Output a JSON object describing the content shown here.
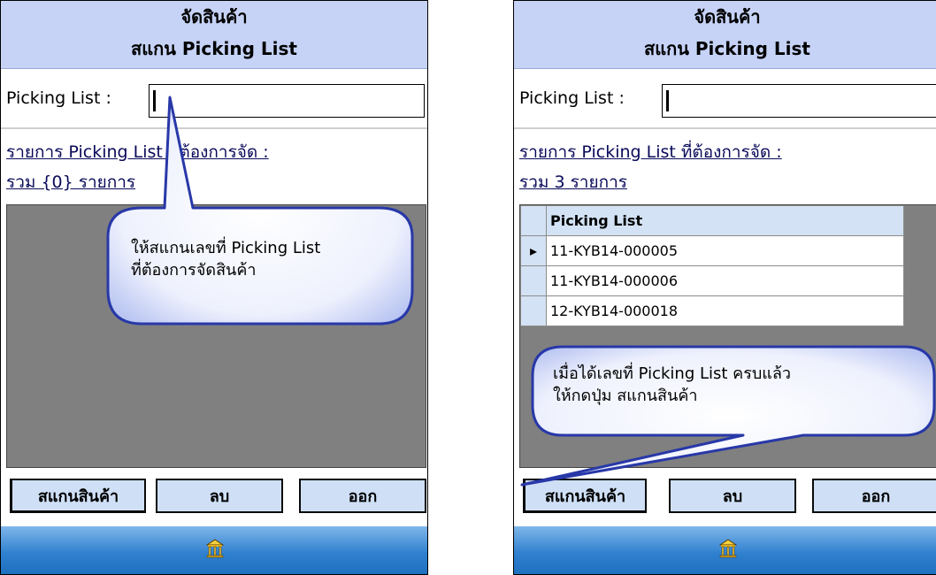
{
  "screens": [
    {
      "title_line1": "จัดสินค้า",
      "title_line2": "สแกน Picking List",
      "field_label": "Picking List :",
      "field_value": "",
      "link_line1": "รายการ Picking List ที่ต้องการจัด :",
      "link_line2": "รวม {0} รายการ",
      "buttons": [
        "สแกนสินค้า",
        "ลบ",
        "ออก"
      ],
      "callout": [
        "ให้สแกนเลขที่ Picking List",
        "ที่ต้องการจัดสินค้า"
      ]
    },
    {
      "title_line1": "จัดสินค้า",
      "title_line2": "สแกน Picking List",
      "field_label": "Picking List :",
      "field_value": "",
      "link_line1": "รายการ Picking List ที่ต้องการจัด :",
      "link_line2": "รวม 3 รายการ",
      "table": {
        "header": "Picking List",
        "rows": [
          "11-KYB14-000005",
          "11-KYB14-000006",
          "12-KYB14-000018"
        ],
        "current_row_indicator": "▸"
      },
      "buttons": [
        "สแกนสินค้า",
        "ลบ",
        "ออก"
      ],
      "callout": [
        "เมื่อได้เลขที่ Picking List ครบแล้ว",
        "ให้กดปุ่ม สแกนสินค้า"
      ]
    }
  ],
  "colors": {
    "titlebar": "#c6d3f7",
    "button": "#cfe0f6",
    "grid_bg": "#808080",
    "callout_fill": "#e4eafc",
    "callout_border": "#2838a8",
    "taskbar": "#2f80cf"
  },
  "icons": {
    "taskbar_home": "temple-home-icon"
  }
}
